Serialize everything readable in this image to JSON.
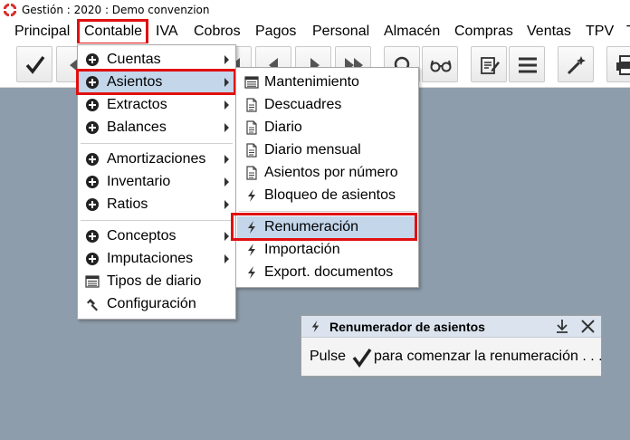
{
  "window": {
    "title": "Gestión : 2020 : Demo convenzion"
  },
  "menubar": {
    "items": [
      "Principal",
      "Contable",
      "IVA",
      "Cobros",
      "Pagos",
      "Personal",
      "Almacén",
      "Compras",
      "Ventas",
      "TPV",
      "T"
    ],
    "active": "Contable"
  },
  "toolbar": {
    "icons": [
      "checkmark-icon",
      "prev-icon",
      "first-icon",
      "back-icon",
      "forward-icon",
      "last-icon",
      "search-icon",
      "glasses-icon",
      "edit-icon",
      "list-icon",
      "magic-wand-icon",
      "printer-icon"
    ]
  },
  "contable_menu": {
    "items": [
      {
        "label": "Cuentas",
        "icon": "plus-circle-icon",
        "submenu": true
      },
      {
        "label": "Asientos",
        "icon": "plus-circle-icon",
        "submenu": true
      },
      {
        "label": "Extractos",
        "icon": "plus-circle-icon",
        "submenu": true
      },
      {
        "label": "Balances",
        "icon": "plus-circle-icon",
        "submenu": true
      },
      {
        "label": "Amortizaciones",
        "icon": "plus-circle-icon",
        "submenu": true
      },
      {
        "label": "Inventario",
        "icon": "plus-circle-icon",
        "submenu": true
      },
      {
        "label": "Ratios",
        "icon": "plus-circle-icon",
        "submenu": true
      },
      {
        "label": "Conceptos",
        "icon": "plus-circle-icon",
        "submenu": true
      },
      {
        "label": "Imputaciones",
        "icon": "plus-circle-icon",
        "submenu": true
      },
      {
        "label": "Tipos de diario",
        "icon": "table-icon",
        "submenu": false
      },
      {
        "label": "Configuración",
        "icon": "hammer-icon",
        "submenu": false
      }
    ]
  },
  "asientos_menu": {
    "items": [
      {
        "label": "Mantenimiento",
        "icon": "table-icon"
      },
      {
        "label": "Descuadres",
        "icon": "document-icon"
      },
      {
        "label": "Diario",
        "icon": "document-icon"
      },
      {
        "label": "Diario mensual",
        "icon": "document-icon"
      },
      {
        "label": "Asientos por número",
        "icon": "document-icon"
      },
      {
        "label": "Bloqueo de asientos",
        "icon": "lightning-icon"
      },
      {
        "label": "Renumeración",
        "icon": "lightning-icon"
      },
      {
        "label": "Importación",
        "icon": "lightning-icon"
      },
      {
        "label": "Export. documentos",
        "icon": "lightning-icon"
      }
    ]
  },
  "dialog": {
    "title": "Renumerador de asientos",
    "message_before": "Pulse",
    "message_after": "para comenzar la renumeración . . ."
  },
  "colors": {
    "highlight": "#c3d6ea",
    "red_box": "#e01010",
    "background": "#8e9dab"
  }
}
